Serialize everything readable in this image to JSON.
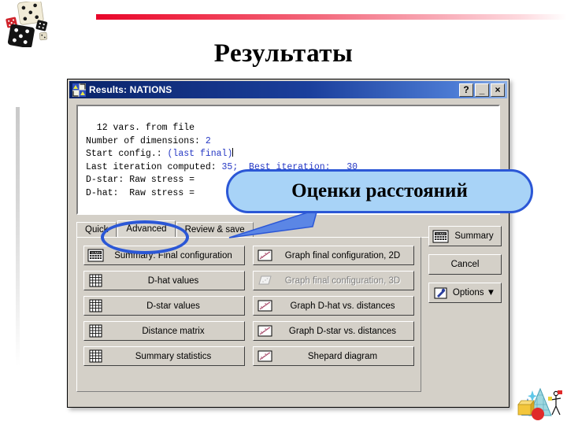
{
  "slide": {
    "title": "Результаты",
    "logo_icon": "dice-logo",
    "corner_icon": "statistics-clipart"
  },
  "dialog": {
    "title": "Results: NATIONS",
    "title_icon": "results-window-icon",
    "window_buttons": [
      {
        "name": "help-button",
        "label": "?"
      },
      {
        "name": "minimize-button",
        "label": "_"
      },
      {
        "name": "close-button",
        "label": "×"
      }
    ],
    "output": {
      "lines": [
        {
          "text": "  12 vars. from file",
          "blue_suffix": ""
        },
        {
          "text": "Number of dimensions: ",
          "blue_suffix": "2"
        },
        {
          "text": "Start config.: ",
          "blue_suffix": "(last final)"
        },
        {
          "text": "Last iteration computed: ",
          "blue_suffix": "35;  Best iteration:   30"
        },
        {
          "text": "D-star: Raw stress = ",
          "blue_suffix": ""
        },
        {
          "text": "D-hat:  Raw stress = ",
          "blue_suffix": ""
        }
      ]
    },
    "tabs": [
      {
        "label": "Quick",
        "selected": false
      },
      {
        "label": "Advanced",
        "selected": true
      },
      {
        "label": "Review & save",
        "selected": false
      }
    ],
    "buttons_left": [
      {
        "label": "Summary: Final configuration",
        "icon": "summary-grid-icon",
        "disabled": false
      },
      {
        "label": "D-hat values",
        "icon": "grid-icon",
        "disabled": false
      },
      {
        "label": "D-star values",
        "icon": "grid-icon",
        "disabled": false
      },
      {
        "label": "Distance matrix",
        "icon": "grid-icon",
        "disabled": false
      },
      {
        "label": "Summary statistics",
        "icon": "grid-icon",
        "disabled": false
      }
    ],
    "buttons_middle": [
      {
        "label": "Graph final configuration, 2D",
        "icon": "scatter-graph-icon",
        "disabled": false
      },
      {
        "label": "Graph final configuration, 3D",
        "icon": "graph-3d-icon",
        "disabled": true
      },
      {
        "label": "Graph D-hat vs. distances",
        "icon": "scatter-graph-icon",
        "disabled": false
      },
      {
        "label": "Graph D-star vs. distances",
        "icon": "scatter-graph-icon",
        "disabled": false
      },
      {
        "label": "Shepard diagram",
        "icon": "scatter-graph-icon",
        "disabled": false
      }
    ],
    "actions": [
      {
        "label": "Summary",
        "icon": "summary-grid-icon"
      },
      {
        "label": "Cancel",
        "icon": ""
      },
      {
        "label": "Options ▼",
        "icon": "options-icon"
      }
    ]
  },
  "annotations": {
    "callout_text": "Оценки расстояний",
    "callout_fill": "#a8d3f7",
    "callout_border": "#2b57d6",
    "circle_target": "Advanced",
    "circle_color": "#2b57d6"
  }
}
